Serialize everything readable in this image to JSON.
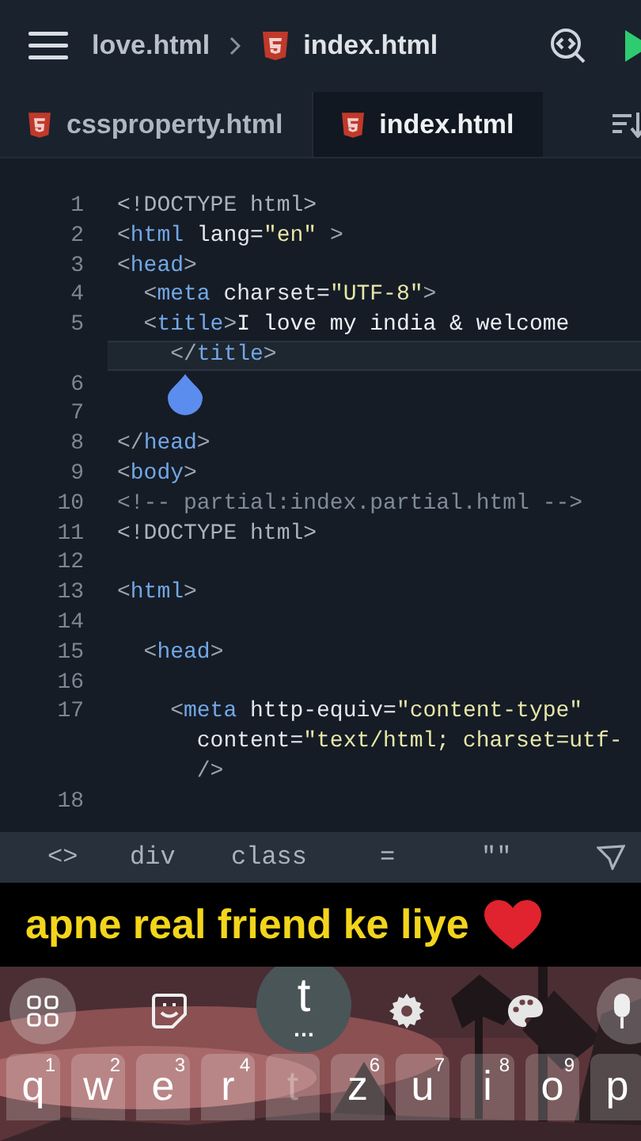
{
  "topbar": {
    "parent": "love.html",
    "current": "index.html"
  },
  "tabs": [
    {
      "label": "cssproperty.html",
      "selected": false
    },
    {
      "label": "index.html",
      "selected": true
    }
  ],
  "editor": {
    "rows": [
      {
        "number": "1",
        "tokens": [
          {
            "kind": "doctype",
            "text": "<!DOCTYPE html>"
          }
        ]
      },
      {
        "number": "2",
        "tokens": [
          {
            "kind": "punct",
            "text": "<"
          },
          {
            "kind": "tag",
            "text": "html"
          },
          {
            "kind": "attr",
            "text": " lang="
          },
          {
            "kind": "string",
            "text": "\"en\""
          },
          {
            "kind": "punct",
            "text": " >"
          }
        ]
      },
      {
        "number": "3",
        "tokens": [
          {
            "kind": "punct",
            "text": "<"
          },
          {
            "kind": "tag",
            "text": "head"
          },
          {
            "kind": "punct",
            "text": ">"
          }
        ],
        "children": [
          {
            "number": "4",
            "tokens": [
              {
                "kind": "punct",
                "text": "<"
              },
              {
                "kind": "tag",
                "text": "meta"
              },
              {
                "kind": "attr",
                "text": " charset="
              },
              {
                "kind": "string",
                "text": "\"UTF-8\""
              },
              {
                "kind": "punct",
                "text": ">"
              }
            ]
          },
          {
            "number": "5",
            "tokens": [
              {
                "kind": "punct",
                "text": "<"
              },
              {
                "kind": "tag",
                "text": "title"
              },
              {
                "kind": "punct",
                "text": ">"
              },
              {
                "kind": "text",
                "text": "I love my india & welcome"
              }
            ],
            "children": [
              {
                "highlighted": true,
                "tokens": [
                  {
                    "kind": "punct",
                    "text": "</"
                  },
                  {
                    "kind": "tag",
                    "text": "title"
                  },
                  {
                    "kind": "punct",
                    "text": ">"
                  }
                ]
              },
              {
                "number": "6",
                "cursor": true
              }
            ]
          }
        ]
      },
      {
        "number": "7"
      },
      {
        "number": "8",
        "tokens": [
          {
            "kind": "punct",
            "text": "</"
          },
          {
            "kind": "tag",
            "text": "head"
          },
          {
            "kind": "punct",
            "text": ">"
          }
        ]
      },
      {
        "number": "9",
        "tokens": [
          {
            "kind": "punct",
            "text": "<"
          },
          {
            "kind": "tag",
            "text": "body"
          },
          {
            "kind": "punct",
            "text": ">"
          }
        ]
      },
      {
        "number": "10",
        "tokens": [
          {
            "kind": "comment",
            "text": "<!-- partial:index.partial.html -->"
          }
        ]
      },
      {
        "number": "11",
        "tokens": [
          {
            "kind": "doctype",
            "text": "<!DOCTYPE html>"
          }
        ]
      },
      {
        "number": "12"
      },
      {
        "number": "13",
        "tokens": [
          {
            "kind": "punct",
            "text": "<"
          },
          {
            "kind": "tag",
            "text": "html"
          },
          {
            "kind": "punct",
            "text": ">"
          }
        ],
        "children": [
          {
            "number": "14"
          },
          {
            "number": "15",
            "tokens": [
              {
                "kind": "punct",
                "text": "<"
              },
              {
                "kind": "tag",
                "text": "head"
              },
              {
                "kind": "punct",
                "text": ">"
              }
            ],
            "children": [
              {
                "number": "16"
              },
              {
                "number": "17",
                "tokens": [
                  {
                    "kind": "punct",
                    "text": "<"
                  },
                  {
                    "kind": "tag",
                    "text": "meta"
                  },
                  {
                    "kind": "attr",
                    "text": " http-equiv="
                  },
                  {
                    "kind": "string",
                    "text": "\"content-type\""
                  }
                ],
                "children": [
                  {
                    "tokens": [
                      {
                        "kind": "attr",
                        "text": "content="
                      },
                      {
                        "kind": "string",
                        "text": "\"text/html; charset=utf-"
                      }
                    ]
                  },
                  {
                    "tokens": [
                      {
                        "kind": "punct",
                        "text": "/>"
                      }
                    ]
                  }
                ]
              },
              {
                "number": "18"
              }
            ]
          }
        ]
      }
    ]
  },
  "symbols": [
    "<>",
    "div",
    "class",
    "=",
    "\"\""
  ],
  "caption": "apne real friend ke liye",
  "keyboard": {
    "popup": {
      "key": "t",
      "hint": "…"
    },
    "keys": [
      {
        "label": "q",
        "hint": "1"
      },
      {
        "label": "w",
        "hint": "2"
      },
      {
        "label": "e",
        "hint": "3"
      },
      {
        "label": "r",
        "hint": "4"
      },
      {
        "label": "t",
        "pressed": true
      },
      {
        "label": "z",
        "hint": "6"
      },
      {
        "label": "u",
        "hint": "7"
      },
      {
        "label": "i",
        "hint": "8"
      },
      {
        "label": "o",
        "hint": "9"
      },
      {
        "label": "p"
      }
    ]
  }
}
